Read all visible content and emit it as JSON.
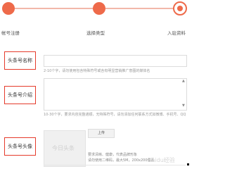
{
  "steps": [
    {
      "label": "帐号注册"
    },
    {
      "label": "选择类型"
    },
    {
      "label": "入驻资料"
    }
  ],
  "form": {
    "name_label": "头条号名称",
    "name_hint": "2-10个字，请勿使用包含特殊符号或含有明显营销推广意图的媒体名",
    "intro_label": "头条号介绍",
    "intro_hint": "10-30个字，要求内容完整通顺，无特殊符号，请勿添加任何联系方式如微博、手机号、QQ",
    "avatar_label": "头条号头像",
    "avatar_placeholder": "今日头条",
    "upload_label": "上传",
    "avatar_req_1": "要求清晰、健康，代表品牌形象",
    "avatar_req_2": "请勿使用二维码，最大5M，200x200像素"
  },
  "watermark": "Baidu经验",
  "colors": {
    "accent": "#ee6a4a",
    "highlight_border": "#e53b2c"
  }
}
